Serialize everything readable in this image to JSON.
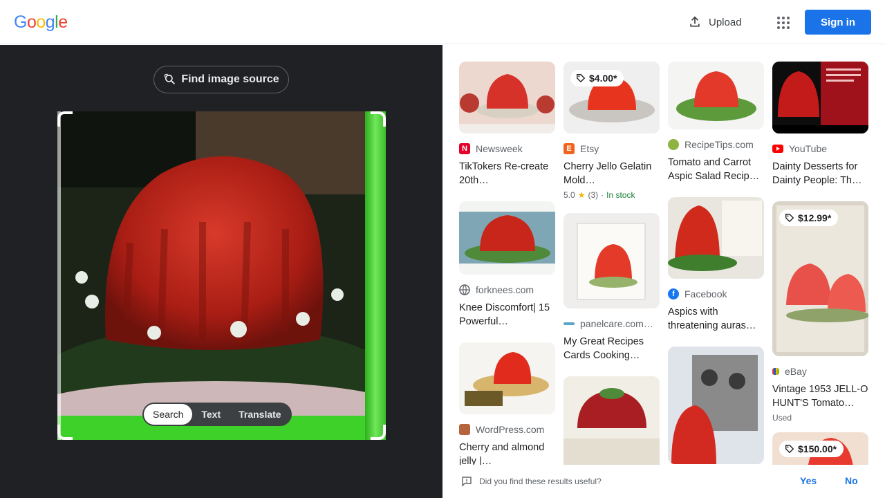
{
  "header": {
    "logo_letters": [
      {
        "ch": "G",
        "color": "#4285F4"
      },
      {
        "ch": "o",
        "color": "#EA4335"
      },
      {
        "ch": "o",
        "color": "#FBBC05"
      },
      {
        "ch": "g",
        "color": "#4285F4"
      },
      {
        "ch": "l",
        "color": "#34A853"
      },
      {
        "ch": "e",
        "color": "#EA4335"
      }
    ],
    "upload_label": "Upload",
    "sign_in_label": "Sign in",
    "accent_color": "#1a73e8"
  },
  "lens": {
    "find_source_label": "Find image source",
    "modes": [
      "Search",
      "Text",
      "Translate"
    ],
    "active_mode": "Search",
    "selection_color": "#4cd137"
  },
  "results": {
    "columns": [
      [
        {
          "source": "Newsweek",
          "favicon": "newsweek-icon",
          "favicon_letter": "N",
          "favicon_color": "#e4002b",
          "title": "TikTokers Re-create 20th…"
        },
        {
          "source": "forknees.com",
          "favicon": "globe-icon",
          "title": "Knee Discomfort| 15 Powerful…"
        },
        {
          "source": "WordPress.com",
          "favicon": "wordpress-icon",
          "title": "Cherry and almond jelly |…"
        }
      ],
      [
        {
          "source": "Etsy",
          "favicon": "etsy-icon",
          "favicon_letter": "E",
          "favicon_color": "#f1641e",
          "title": "Cherry Jello Gelatin Mold…",
          "price": "$4.00*",
          "rating": "5.0",
          "reviews": "(3)",
          "stock": "In stock"
        },
        {
          "source": "panelcare.com…",
          "favicon": "panelcare-icon",
          "title": "My Great Recipes Cards Cooking…"
        },
        {
          "source": "",
          "favicon": "",
          "title": ""
        }
      ],
      [
        {
          "source": "RecipeTips.com",
          "favicon": "recipetips-icon",
          "title": "Tomato and Carrot Aspic Salad Recip…"
        },
        {
          "source": "Facebook",
          "favicon": "facebook-icon",
          "favicon_letter": "f",
          "favicon_color": "#1877f2",
          "title": "Aspics with threatening auras…"
        },
        {
          "source": "",
          "favicon": "",
          "title": ""
        }
      ],
      [
        {
          "source": "YouTube",
          "favicon": "youtube-icon",
          "favicon_color": "#ff0000",
          "title": "Dainty Desserts for Dainty People: Th…"
        },
        {
          "source": "eBay",
          "favicon": "ebay-icon",
          "title": "Vintage 1953 JELL-O HUNT'S Tomato…",
          "price": "$12.99*",
          "condition": "Used"
        },
        {
          "source": "",
          "favicon": "",
          "title": "",
          "price": "$150.00*"
        }
      ]
    ]
  },
  "feedback": {
    "question": "Did you find these results useful?",
    "yes_label": "Yes",
    "no_label": "No"
  }
}
